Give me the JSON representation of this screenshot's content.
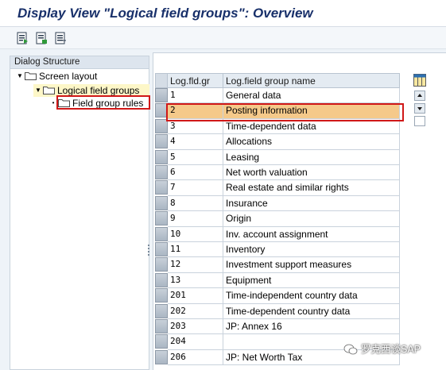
{
  "window": {
    "title": "Display View \"Logical field groups\": Overview"
  },
  "toolbar": {
    "icons": [
      "details-icon",
      "print-icon",
      "export-icon"
    ]
  },
  "dialog_structure": {
    "header": "Dialog Structure",
    "items": [
      {
        "label": "Screen layout",
        "expanded": true,
        "level": 0
      },
      {
        "label": "Logical field groups",
        "expanded": true,
        "level": 1,
        "selected": true
      },
      {
        "label": "Field group rules",
        "expanded": false,
        "level": 2,
        "highlighted": true
      }
    ]
  },
  "table": {
    "columns": [
      "Log.fld.gr",
      "Log.field group name"
    ],
    "rows": [
      {
        "code": "1",
        "name": "General data"
      },
      {
        "code": "2",
        "name": "Posting information",
        "selected": true
      },
      {
        "code": "3",
        "name": "Time-dependent data"
      },
      {
        "code": "4",
        "name": "Allocations"
      },
      {
        "code": "5",
        "name": "Leasing"
      },
      {
        "code": "6",
        "name": "Net worth valuation"
      },
      {
        "code": "7",
        "name": "Real estate and similar rights"
      },
      {
        "code": "8",
        "name": "Insurance"
      },
      {
        "code": "9",
        "name": "Origin"
      },
      {
        "code": "10",
        "name": "Inv. account assignment"
      },
      {
        "code": "11",
        "name": "Inventory"
      },
      {
        "code": "12",
        "name": "Investment support measures"
      },
      {
        "code": "13",
        "name": "Equipment"
      },
      {
        "code": "201",
        "name": "Time-independent country data"
      },
      {
        "code": "202",
        "name": "Time-dependent country data"
      },
      {
        "code": "203",
        "name": "JP: Annex 16"
      },
      {
        "code": "204",
        "name": ""
      },
      {
        "code": "206",
        "name": "JP: Net Worth Tax"
      }
    ]
  },
  "watermark": {
    "text": "罗克西谈SAP"
  },
  "colors": {
    "title": "#18306a",
    "selected_row": "#f5c98a",
    "highlight_border": "#d01818",
    "tree_selected": "#fdf7c8"
  }
}
